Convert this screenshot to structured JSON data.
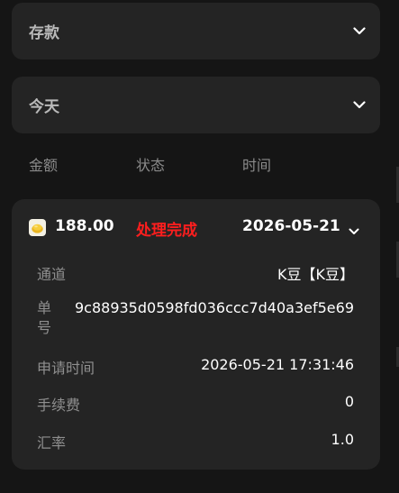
{
  "filters": {
    "type": {
      "label": "存款"
    },
    "date": {
      "label": "今天"
    }
  },
  "columns": [
    "金额",
    "状态",
    "时间"
  ],
  "record": {
    "amount": "188.00",
    "status": "处理完成",
    "date": "2026-05-21",
    "status_color": "#ff1e1e",
    "details": [
      {
        "label": "通道",
        "value": "K豆【K豆】"
      },
      {
        "label": "单号",
        "value": "9c88935d0598fd036ccc7d40a3ef5e69"
      },
      {
        "label": "申请时间",
        "value": "2026-05-21 17:31:46"
      },
      {
        "label": "手续费",
        "value": "0"
      },
      {
        "label": "汇率",
        "value": "1.0"
      }
    ]
  },
  "icons": {
    "coin": "coin-icon",
    "chevron": "chevron-down-icon"
  }
}
